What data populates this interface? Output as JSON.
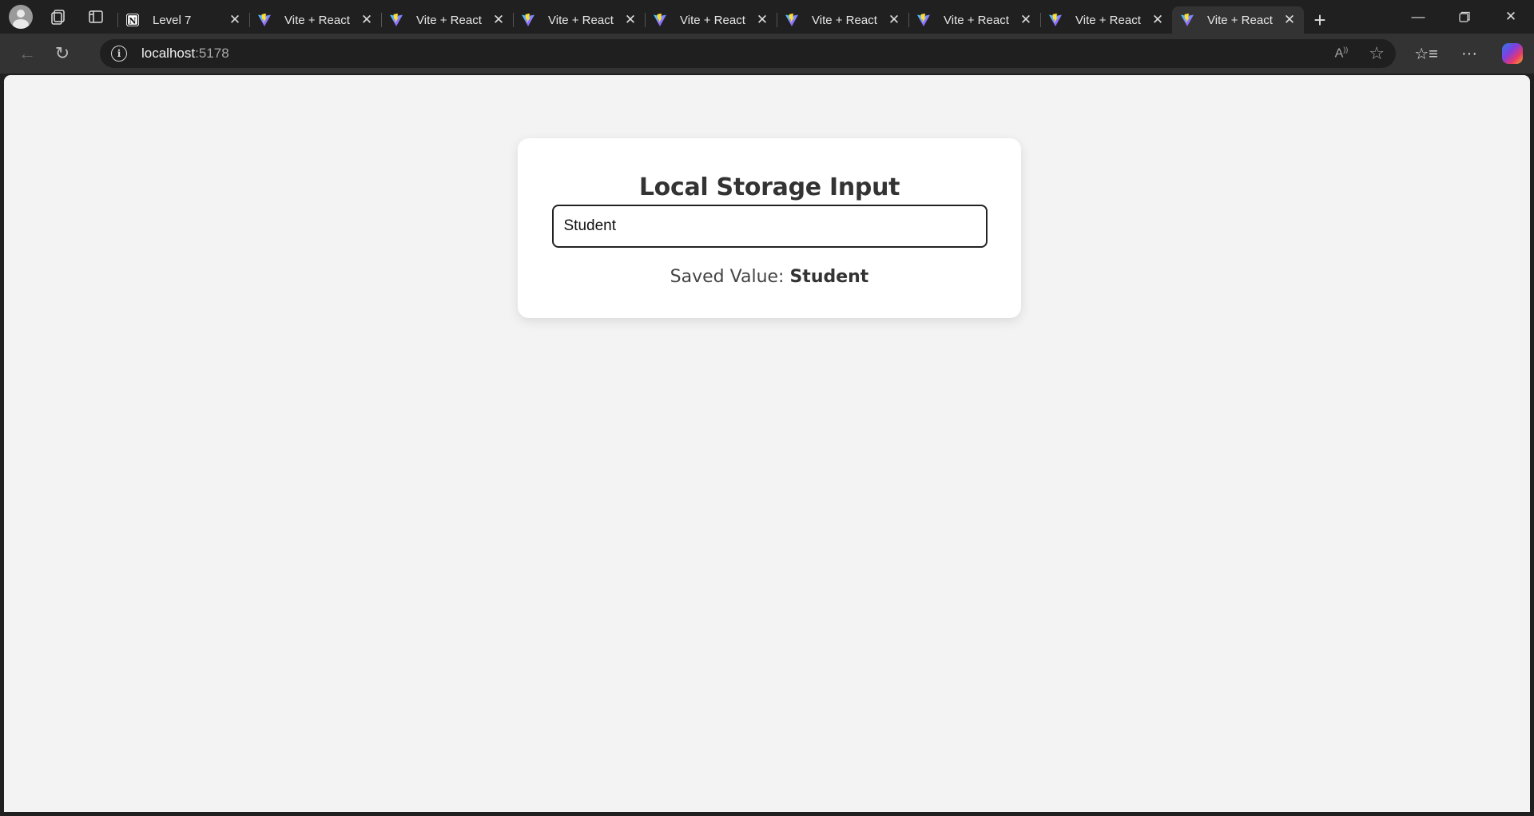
{
  "browser": {
    "tabs": [
      {
        "title": "Level 7",
        "icon": "notion-icon",
        "active": false
      },
      {
        "title": "Vite + React",
        "icon": "vite-icon",
        "active": false
      },
      {
        "title": "Vite + React",
        "icon": "vite-icon",
        "active": false
      },
      {
        "title": "Vite + React",
        "icon": "vite-icon",
        "active": false
      },
      {
        "title": "Vite + React",
        "icon": "vite-icon",
        "active": false
      },
      {
        "title": "Vite + React",
        "icon": "vite-icon",
        "active": false
      },
      {
        "title": "Vite + React",
        "icon": "vite-icon",
        "active": false
      },
      {
        "title": "Vite + React",
        "icon": "vite-icon",
        "active": false
      },
      {
        "title": "Vite + React",
        "icon": "vite-icon",
        "active": true
      }
    ],
    "address": {
      "host": "localhost",
      "port": ":5178"
    },
    "colors": {
      "tabstrip": "#202020",
      "toolbar": "#333333",
      "page_bg": "#f3f3f3"
    }
  },
  "page": {
    "title": "Local Storage Input",
    "input_value": "Student",
    "saved_label": "Saved Value: ",
    "saved_value": "Student"
  }
}
